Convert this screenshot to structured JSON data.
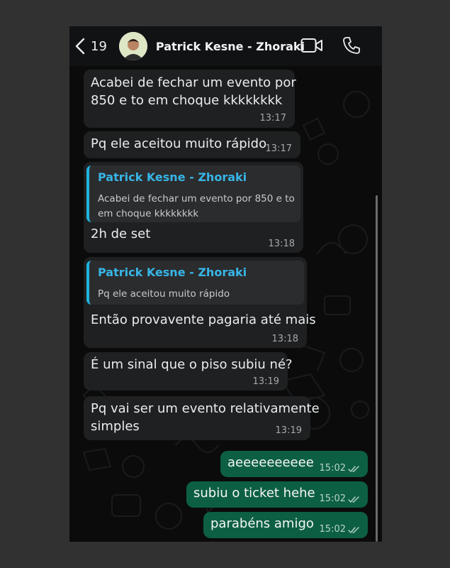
{
  "header": {
    "back_count": "19",
    "contact_name": "Patrick Kesne - Zhoraki"
  },
  "messages": [
    {
      "text1": "Acabei de fechar um evento por",
      "text2": "850 e to em choque kkkkkkkk",
      "time": "13:17"
    },
    {
      "text": "Pq ele aceitou muito rápido",
      "time": "13:17"
    },
    {
      "quote_name": "Patrick Kesne - Zhoraki",
      "quote_line1": "Acabei de fechar um evento por 850 e to",
      "quote_line2": "em choque kkkkkkkk",
      "text": "2h de set",
      "time": "13:18"
    },
    {
      "quote_name": "Patrick Kesne - Zhoraki",
      "quote_line1": "Pq ele aceitou muito rápido",
      "text": "Então provavente pagaria até mais",
      "time": "13:18"
    },
    {
      "text": "É um sinal que o piso subiu né?",
      "time": "13:19"
    },
    {
      "text1": "Pq vai ser um evento relativamente",
      "text2": "simples",
      "time": "13:19"
    },
    {
      "text": "aeeeeeeeeee",
      "time": "15:02"
    },
    {
      "text": "subiu o ticket hehe",
      "time": "15:02"
    },
    {
      "text": "parabéns amigo",
      "time": "15:02"
    }
  ],
  "colors": {
    "incoming_bubble": "#1f2021",
    "outgoing_bubble": "#0d5f43",
    "quote_accent": "#1eb4e0",
    "background": "#0b0b0b"
  }
}
